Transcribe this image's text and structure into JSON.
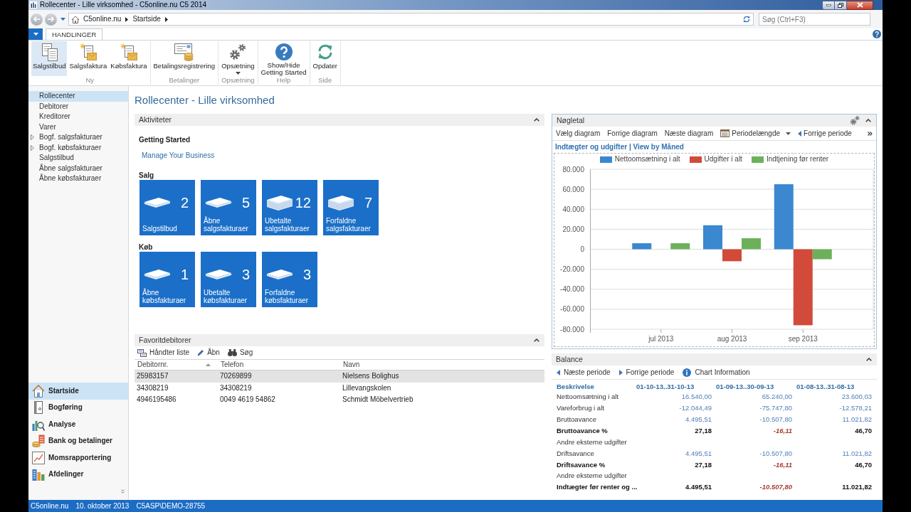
{
  "window": {
    "title": "Rollecenter - Lille virksomhed - C5online.nu C5 2014"
  },
  "address_bar": {
    "breadcrumb": [
      "C5online.nu",
      "Startside"
    ],
    "search": {
      "placeholder": "Søg (Ctrl+F3)"
    }
  },
  "ribbon": {
    "tabs": [
      {
        "label": "HANDLINGER",
        "selected": true
      }
    ],
    "groups": [
      {
        "label": "Ny",
        "buttons": [
          {
            "label": "Salgstilbud",
            "highlighted": true,
            "dropdown": false
          },
          {
            "label": "Salgsfaktura",
            "highlighted": false,
            "dropdown": false
          },
          {
            "label": "Købsfaktura",
            "highlighted": false,
            "dropdown": false
          }
        ]
      },
      {
        "label": "Betalinger",
        "buttons": [
          {
            "label": "Betalingsregistrering",
            "highlighted": false,
            "dropdown": false
          }
        ]
      },
      {
        "label": "Opsætning",
        "buttons": [
          {
            "label": "Opsætning",
            "highlighted": false,
            "dropdown": true
          }
        ]
      },
      {
        "label": "Help",
        "buttons": [
          {
            "label": "Show/Hide\nGetting Started",
            "highlighted": false,
            "dropdown": false
          }
        ]
      },
      {
        "label": "Side",
        "buttons": [
          {
            "label": "Opdater",
            "highlighted": false,
            "dropdown": false
          }
        ]
      }
    ]
  },
  "navigation": {
    "items": [
      {
        "label": "Rollecenter",
        "kind": "page",
        "selected": true
      },
      {
        "label": "Debitorer",
        "kind": "page",
        "selected": false
      },
      {
        "label": "Kreditorer",
        "kind": "page",
        "selected": false
      },
      {
        "label": "Varer",
        "kind": "page",
        "selected": false
      },
      {
        "label": "Bogf. salgsfakturaer",
        "kind": "folder",
        "expanded": false,
        "selected": false
      },
      {
        "label": "Bogf. købsfakturaer",
        "kind": "folder",
        "expanded": false,
        "selected": false
      },
      {
        "label": "Salgstilbud",
        "kind": "page",
        "selected": false
      },
      {
        "label": "Åbne salgsfakturaer",
        "kind": "page",
        "selected": false
      },
      {
        "label": "Åbne købsfakturaer",
        "kind": "page",
        "selected": false
      }
    ]
  },
  "departments": {
    "items": [
      {
        "label": "Startside",
        "selected": true
      },
      {
        "label": "Bogføring",
        "selected": false
      },
      {
        "label": "Analyse",
        "selected": false
      },
      {
        "label": "Bank og betalinger",
        "selected": false
      },
      {
        "label": "Momsrapportering",
        "selected": false
      },
      {
        "label": "Afdelinger",
        "selected": false
      }
    ]
  },
  "page_title": "Rollecenter - Lille virksomhed",
  "activities": {
    "title": "Aktiviteter",
    "expanded": true,
    "getting_started": {
      "title": "Getting Started",
      "link": "Manage Your Business"
    },
    "groups": [
      {
        "label": "Salg",
        "tiles": [
          {
            "label": "Salgstilbud",
            "count": "2"
          },
          {
            "label": "Åbne salgsfakturaer",
            "count": "5"
          },
          {
            "label": "Ubetalte salgsfakturaer",
            "count": "12"
          },
          {
            "label": "Forfaldne salgsfakturaer",
            "count": "7"
          }
        ]
      },
      {
        "label": "Køb",
        "tiles": [
          {
            "label": "Åbne købsfakturaer",
            "count": "1"
          },
          {
            "label": "Ubetalte købsfakturaer",
            "count": "3"
          },
          {
            "label": "Forfaldne købsfakturaer",
            "count": "3"
          }
        ]
      }
    ]
  },
  "favorites": {
    "title": "Favoritdebitorer",
    "expanded": true,
    "actions": [
      "Håndter liste",
      "Åbn",
      "Søg"
    ],
    "columns": [
      {
        "label": "Debitornr.",
        "sorted": true
      },
      {
        "label": "Telefon",
        "sorted": false
      },
      {
        "label": "Navn",
        "sorted": false
      }
    ],
    "rows": [
      {
        "selected": true,
        "cells": [
          "25983157",
          "70269899",
          "Nielsens Bolighus"
        ]
      },
      {
        "selected": false,
        "cells": [
          "34308219",
          "34308219",
          "Lillevangskolen"
        ]
      },
      {
        "selected": false,
        "cells": [
          "4946195486",
          "0049 4619 54862",
          "Schmidt Möbelvertrieb"
        ]
      }
    ]
  },
  "key_figures": {
    "title": "Nøgletal",
    "expanded": true,
    "actions": [
      {
        "label": "Vælg diagram",
        "dropdown": false
      },
      {
        "label": "Forrige diagram",
        "dropdown": false
      },
      {
        "label": "Næste diagram",
        "dropdown": false
      },
      {
        "label": "Periodelængde",
        "dropdown": true
      },
      {
        "label": "Forrige periode",
        "dropdown": false
      }
    ],
    "chart_data": [
      {
        "type": "bar",
        "title": "Indtægter og udgifter | View by Måned",
        "categories": [
          "jul 2013",
          "aug 2013",
          "sep 2013"
        ],
        "series": [
          {
            "name": "Nettoomsætning i alt",
            "color": "#3b87d0",
            "values": [
              6000,
              24000,
              65000
            ]
          },
          {
            "name": "Udgifter i alt",
            "color": "#d24a3a",
            "values": [
              null,
              -12000,
              -76000
            ]
          },
          {
            "name": "Indtjening før renter",
            "color": "#6cb15a",
            "values": [
              6000,
              11000,
              -10000
            ]
          }
        ],
        "ylim": [
          -80000,
          80000
        ],
        "yticks": [
          {
            "value": 80000,
            "label": "80.000"
          },
          {
            "value": 60000,
            "label": "60.000"
          },
          {
            "value": 40000,
            "label": "40.000"
          },
          {
            "value": 20000,
            "label": "20.000"
          },
          {
            "value": 0,
            "label": "0"
          },
          {
            "value": -20000,
            "label": "-20.000"
          },
          {
            "value": -40000,
            "label": "-40.000"
          },
          {
            "value": -60000,
            "label": "-60.000"
          },
          {
            "value": -80000,
            "label": "-80.000"
          }
        ],
        "grid": true,
        "legend": "top"
      }
    ]
  },
  "balance": {
    "title": "Balance",
    "expanded": true,
    "actions": [
      "Næste periode",
      "Forrige periode",
      "Chart Information"
    ],
    "columns": [
      "Beskrivelse",
      "01-10-13..31-10-13",
      "01-09-13..30-09-13",
      "01-08-13..31-08-13"
    ],
    "rows": [
      {
        "kind": "detail",
        "label": "Nettoomsætning i alt",
        "values": [
          "16.540,00",
          "65.240,00",
          "23.600,03"
        ]
      },
      {
        "kind": "detail",
        "label": "Vareforbrug i alt",
        "values": [
          "-12.044,49",
          "-75.747,80",
          "-12.578,21"
        ]
      },
      {
        "kind": "detail",
        "label": "Bruttoavance",
        "values": [
          "4.495,51",
          "-10.507,80",
          "11.021,82"
        ]
      },
      {
        "kind": "total",
        "label": "Bruttoavance %",
        "values": [
          {
            "text": "27,18",
            "alert": false
          },
          {
            "text": "-16,11",
            "alert": true
          },
          {
            "text": "46,70",
            "alert": false
          }
        ]
      },
      {
        "kind": "detail",
        "label": "Andre eksterne udgifter"
      },
      {
        "kind": "detail",
        "label": "Driftsavance",
        "values": [
          "4.495,51",
          "-10.507,80",
          "11.021,82"
        ]
      },
      {
        "kind": "total",
        "label": "Driftsavance %",
        "values": [
          {
            "text": "27,18",
            "alert": false
          },
          {
            "text": "-16,11",
            "alert": true
          },
          {
            "text": "46,70",
            "alert": false
          }
        ]
      },
      {
        "kind": "detail",
        "label": "Andre eksterne udgifter"
      },
      {
        "kind": "total",
        "label": "Indtægter før renter og ...",
        "values": [
          {
            "text": "4.495,51",
            "alert": false
          },
          {
            "text": "-10.507,80",
            "alert": true
          },
          {
            "text": "11.021,82",
            "alert": false
          }
        ]
      }
    ]
  },
  "status_bar": {
    "items": [
      "C5online.nu",
      "10. oktober 2013",
      "C5ASP\\DEMO-28755"
    ]
  }
}
